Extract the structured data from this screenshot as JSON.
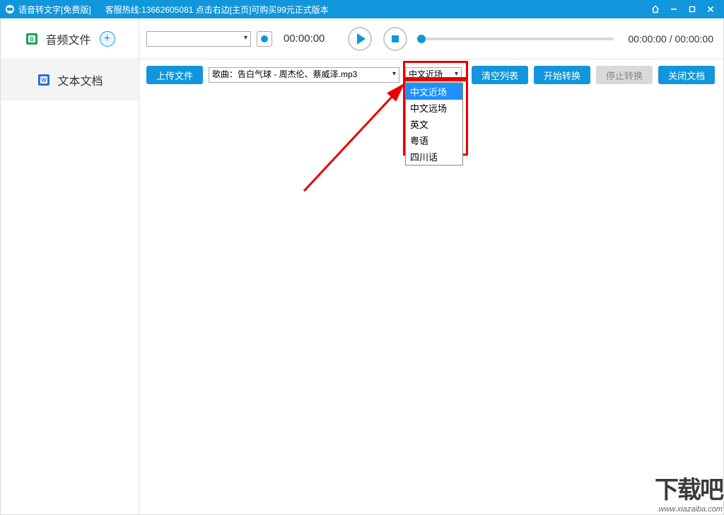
{
  "titlebar": {
    "title": "语音转文字[免费版]",
    "hotline": "客服热线:13662605081  点击右边[主页]可购买99元正式版本"
  },
  "sidebar": {
    "items": [
      {
        "label": "音频文件"
      },
      {
        "label": "文本文档"
      }
    ]
  },
  "player": {
    "rec_time": "00:00:00",
    "pos_time": "00:00:00",
    "dur_time": "00:00:00"
  },
  "toolbar": {
    "upload_label": "上传文件",
    "file_selected": "歌曲：告白气球 - 周杰伦、蔡威泽.mp3",
    "lang_selected": "中文近场",
    "lang_options": [
      "中文近场",
      "中文远场",
      "英文",
      "粤语",
      "四川话"
    ],
    "clear_label": "清空列表",
    "start_label": "开始转换",
    "stop_label": "停止转换",
    "close_label": "关闭文档"
  },
  "watermark": {
    "text": "下载吧",
    "url": "www.xiazaiba.com"
  }
}
